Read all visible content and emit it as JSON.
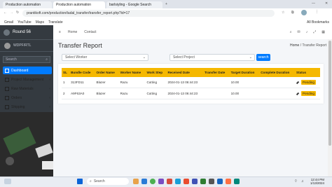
{
  "browser": {
    "tabs": [
      {
        "label": "Production automation"
      },
      {
        "label": "Production automation"
      },
      {
        "label": "barlsiyling - Google Search"
      }
    ],
    "url": "prantikoft.com/production/tadal_transfer/transfer_report.php?id=17",
    "bookmarks": [
      "Gmail",
      "YouTube",
      "Maps",
      "Translate"
    ],
    "bookmarks_right": "All Bookmarks"
  },
  "app": {
    "brand": "Round 56",
    "user": "WDPF/RTL",
    "search_placeholder": "Search",
    "nav": [
      {
        "label": "Dashboard"
      },
      {
        "label": "Project Management"
      },
      {
        "label": "Raw Materials"
      },
      {
        "label": "Orders"
      },
      {
        "label": "Shipping"
      }
    ],
    "topnav": {
      "home": "Home",
      "contact": "Contact"
    }
  },
  "page": {
    "title": "Transfer Report",
    "breadcrumb": {
      "home": "Home",
      "sep": "/",
      "current": "Transfer Report"
    },
    "worker_select": "Select Worker",
    "project_select": "Select Project",
    "search_button": "search"
  },
  "table": {
    "headers": [
      "SL",
      "Bundle Code",
      "Order Name",
      "Worker Name",
      "Work Step",
      "Received Date",
      "Transfer Date",
      "Target Duration",
      "Complete Duration",
      "Status"
    ],
    "rows": [
      {
        "sl": "1",
        "bundle": "313FD11",
        "order": "Blazer",
        "worker": "Razu",
        "step": "Cutting",
        "received": "2024-01-13 06:44:23",
        "transfer": "",
        "target": "10.00",
        "complete": "",
        "status": "Pending"
      },
      {
        "sl": "2",
        "bundle": "A9F63A0",
        "order": "Blazer",
        "worker": "Razu",
        "step": "Cutting",
        "received": "2024-01-13 06:44:23",
        "transfer": "",
        "target": "10.00",
        "complete": "",
        "status": "Pending"
      }
    ]
  },
  "taskbar": {
    "search_placeholder": "Search",
    "time": "12:44 PM",
    "date": "1/13/2024"
  },
  "colors": {
    "accent": "#007bff",
    "header": "#f5b800",
    "sidebar": "#343a40"
  }
}
